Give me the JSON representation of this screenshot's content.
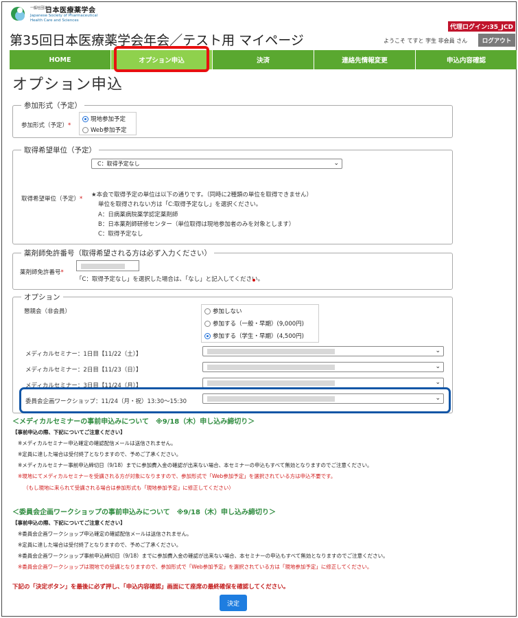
{
  "header": {
    "logo_small": "一般社団法人",
    "logo_name": "日本医療薬学会",
    "logo_en1": "Japanese Society of Pharmaceutical",
    "logo_en2": "Health Care and Sciences",
    "proxy_login": "代理ログイン:35_JCD",
    "page_title": "第35回日本医療薬学会年会／テスト用 マイページ",
    "welcome": "ようこそ てすと 字生 非会員 さん",
    "logout_label": "ログアウト"
  },
  "nav": {
    "items": [
      {
        "label": "HOME"
      },
      {
        "label": "オプション申込"
      },
      {
        "label": "決済"
      },
      {
        "label": "連絡先情報変更"
      },
      {
        "label": "申込内容確認"
      }
    ]
  },
  "section_heading": "オプション申込",
  "participation": {
    "legend": "参加形式（予定）",
    "label": "参加形式（予定）",
    "required_mark": "*",
    "options": [
      "現地参加予定",
      "Web参加予定"
    ],
    "selected": "現地参加予定"
  },
  "credit": {
    "legend": "取得希望単位（予定）",
    "label": "取得希望単位（予定）",
    "required_mark": "*",
    "select_value": "C：取得予定なし",
    "notes": [
      "★本会で取得予定の単位は以下の通りです。（同時に2種類の単位を取得できません）",
      "単位を取得されない方は「C:取得予定なし」を選択ください。",
      "A：日病薬病院薬学認定薬剤師",
      "B：日本薬剤師研修センター（単位取得は現地参加者のみを対象とします）",
      "C：取得予定なし"
    ]
  },
  "license": {
    "legend": "薬剤師免許番号（取得希望される方は必ず入力ください）",
    "label": "薬剤師免許番号",
    "required_mark": "*",
    "note": "「C：取得予定なし」を選択した場合は、「なし」と記入してください。"
  },
  "options": {
    "legend": "オプション",
    "party_label": "懇親会（非会員）",
    "party_options": [
      "参加しない",
      "参加する（一般・早期）(9,000円)",
      "参加する（学生・早期）(4,500円)"
    ],
    "party_selected": "参加する（学生・早期）(4,500円)",
    "seminar_rows": [
      "メディカルセミナー：1日目【11/22（土）】",
      "メディカルセミナー：2日目【11/23（日）】",
      "メディカルセミナー：3日目【11/24（月）】",
      "委員会企画ワークショップ：11/24（月・祝）13:30〜15:30"
    ]
  },
  "medical_info": {
    "title": "＜メディカルセミナーの事前申込みについて　※9/18（木）申し込み締切り＞",
    "subtitle": "【事前申込の際、下記についてご注意ください】",
    "lines": [
      "※メディカルセミナー申込確定の確認配信メールは送信されません。",
      "※定員に達した場合は受付終了となりますので、予めご了承ください。",
      "※メディカルセミナー事前申込締切日（9/18）までに参加費入金の確認が出来ない場合、本セミナーの申込もすべて無効となりますのでご注意ください。"
    ],
    "red_lines": [
      "※現地にてメディカルセミナーを受講される方が対象になりますので、参加形式で「Web参加予定」を選択されている方は申込不要です。",
      "（もし現地に来られて受講される場合は参加形式も「現地参加予定」に修正してください）"
    ]
  },
  "workshop_info": {
    "title": "＜委員会企画ワークショップの事前申込みについて　※9/18（木）申し込み締切り＞",
    "subtitle": "【事前申込の際、下記についてご注意ください】",
    "lines": [
      "※委員会企画ワークショップ申込確定の確認配信メールは送信されません。",
      "※定員に達した場合は受付終了となりますので、予めご了承ください。",
      "※委員会企画ワークショップ事前申込締切日（9/18）までに参加費入金の確認が出来ない場合、本セミナーの申込もすべて無効となりますのでご注意ください。"
    ],
    "red_line": "※委員会企画ワークショップは現地での受講となりますので、参加形式で「Web参加予定」を選択されている方は「現地参加予定」に修正してください。"
  },
  "final_note": "下記の「決定ボタン」を最後に必ず押し、「申込内容確認」画面にて座席の最終確保を確認してください。",
  "submit_label": "決定",
  "colors": {
    "nav_green": "#5aa830",
    "nav_active": "#8fd14d",
    "highlight_red": "#e81010",
    "highlight_blue": "#1256a6",
    "heading_green": "#2e8b3e",
    "warning_red": "#d01818",
    "submit_blue": "#1e7de0"
  }
}
